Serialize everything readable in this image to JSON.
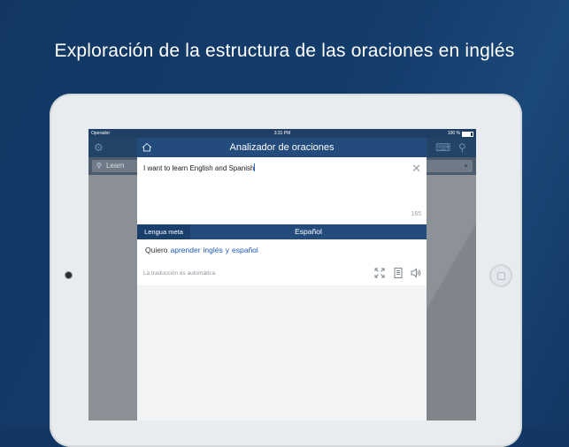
{
  "headline": "Exploración de la estructura de las oraciones en inglés",
  "status_bar": {
    "carrier": "Operador",
    "time": "3:31 PM",
    "battery": "100 %"
  },
  "background_app": {
    "search_text": "Learn"
  },
  "modal": {
    "title": "Analizador de oraciones",
    "input_text": "I want to learn English and Spanish",
    "char_count": "165",
    "target_label": "Lengua meta",
    "target_language": "Español",
    "result": {
      "plain": "Quiero",
      "words": [
        "aprender",
        "inglés",
        "y",
        "español"
      ]
    },
    "auto_note": "La traducción es automática"
  },
  "icons": {
    "home": "home-icon",
    "close": "close-icon",
    "expand": "expand-icon",
    "document": "document-icon",
    "speaker": "speaker-icon",
    "settings": "gear-icon",
    "keyboard": "keyboard-icon",
    "search": "search-icon"
  },
  "colors": {
    "background": "#123763",
    "header_blue": "#234b7c",
    "link_blue": "#1e58b3"
  }
}
